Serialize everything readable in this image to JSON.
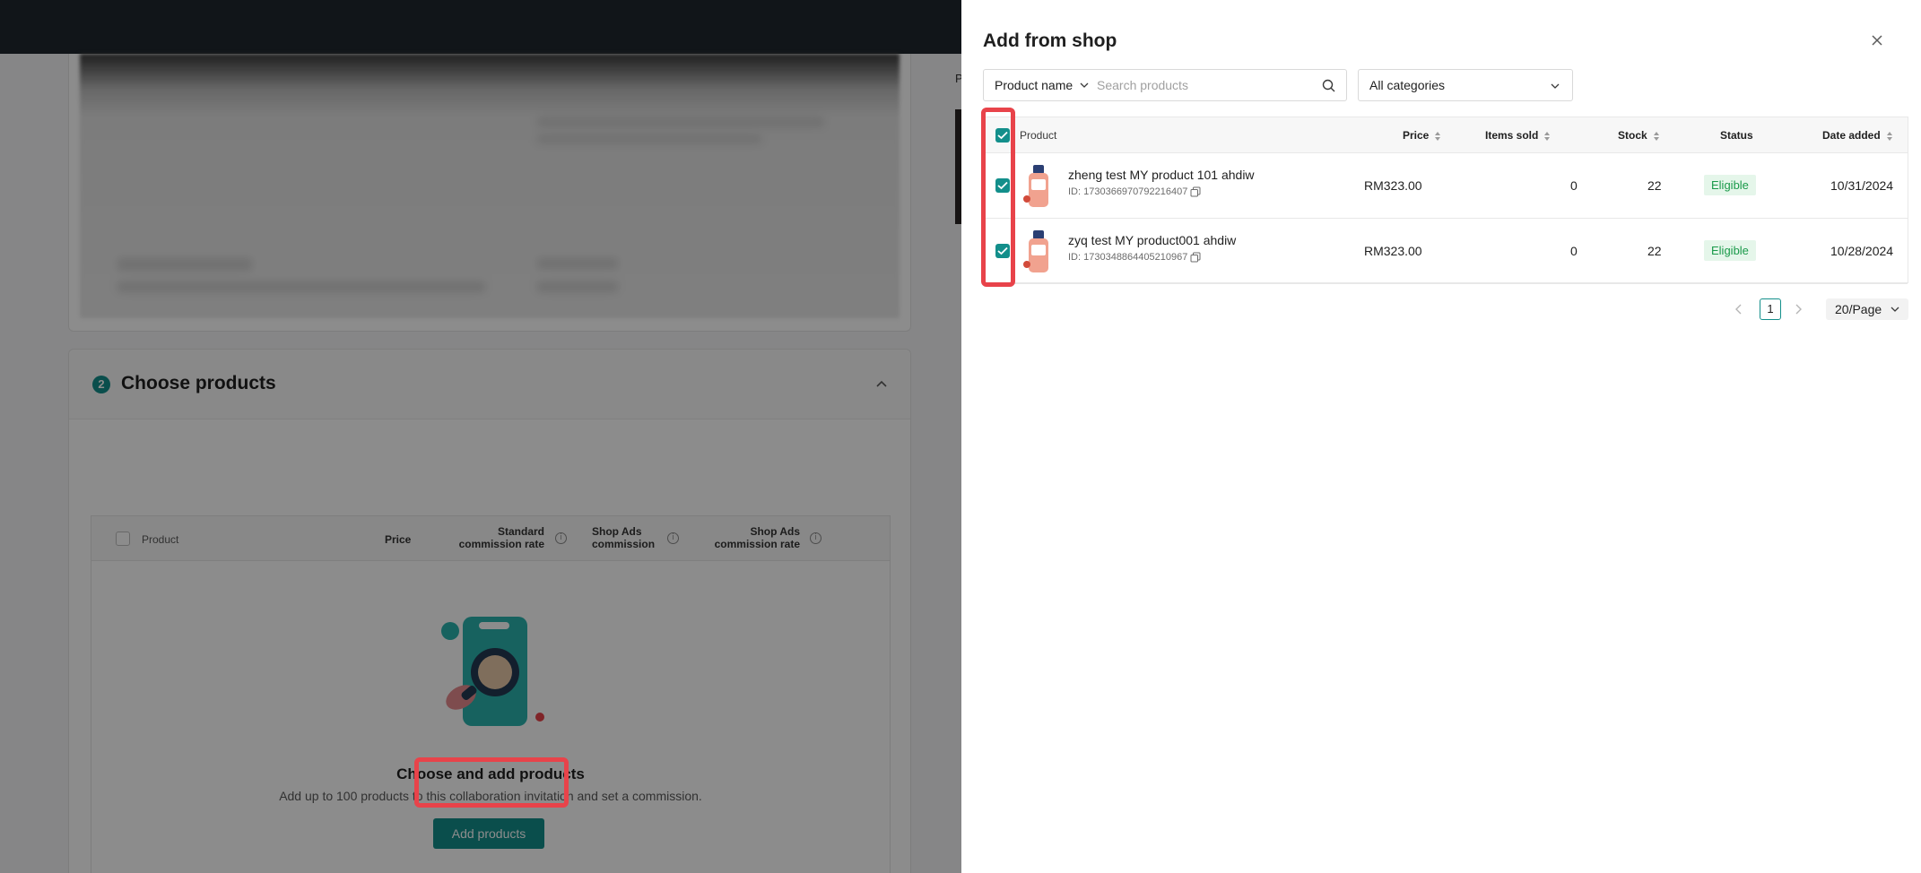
{
  "background": {
    "section": {
      "step_number": "2",
      "title": "Choose products"
    },
    "product_table": {
      "headers": {
        "product": "Product",
        "price": "Price",
        "standard_rate": "Standard commission rate",
        "shop_ads_commission": "Shop Ads commission",
        "shop_ads_rate": "Shop Ads commission rate"
      }
    },
    "empty_state": {
      "title": "Choose and add products",
      "description": "Add up to 100 products to this collaboration invitation and set a commission.",
      "button_label": "Add products"
    },
    "peek_label": "P"
  },
  "drawer": {
    "title": "Add from shop",
    "search": {
      "field_label": "Product name",
      "placeholder": "Search products"
    },
    "category_filter": "All categories",
    "table": {
      "headers": {
        "product": "Product",
        "price": "Price",
        "items_sold": "Items sold",
        "stock": "Stock",
        "status": "Status",
        "date_added": "Date added"
      },
      "rows": [
        {
          "name": "zheng test MY product 101 ahdiw",
          "id": "ID: 1730366970792216407",
          "price": "RM323.00",
          "items_sold": "0",
          "stock": "22",
          "status": "Eligible",
          "date_added": "10/31/2024",
          "checked": true
        },
        {
          "name": "zyq test MY product001 ahdiw",
          "id": "ID: 1730348864405210967",
          "price": "RM323.00",
          "items_sold": "0",
          "stock": "22",
          "status": "Eligible",
          "date_added": "10/28/2024",
          "checked": true
        }
      ]
    },
    "pagination": {
      "current_page": "1",
      "per_page": "20/Page"
    }
  },
  "colors": {
    "accent": "#138f8b",
    "highlight": "#e8434a",
    "eligible_bg": "#e5f6ea",
    "eligible_text": "#1a9a4a"
  }
}
